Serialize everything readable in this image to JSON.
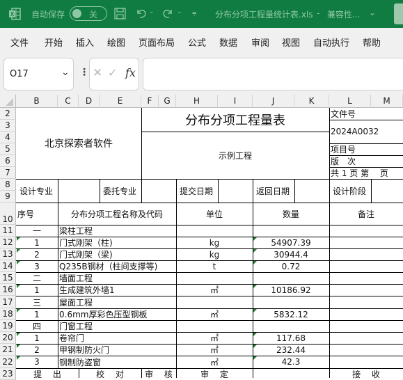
{
  "titlebar": {
    "autosave_label": "自动保存",
    "autosave_state": "关",
    "file_title": "分布分项工程量统计表.xls",
    "separator": "-",
    "mode": "兼容性..."
  },
  "menu": [
    "文件",
    "开始",
    "插入",
    "绘图",
    "页面布局",
    "公式",
    "数据",
    "审阅",
    "视图",
    "自动执行",
    "帮助"
  ],
  "formula_bar": {
    "name_box": "O17",
    "formula": ""
  },
  "columns": [
    "B",
    "C",
    "D",
    "E",
    "F",
    "G",
    "H",
    "I",
    "J",
    "K",
    "L",
    "M"
  ],
  "rows": [
    "2",
    "3",
    "4",
    "5",
    "6",
    "7",
    "8",
    "9",
    "10",
    "11",
    "12",
    "13",
    "14",
    "15",
    "16",
    "17",
    "18",
    "19",
    "20",
    "21",
    "22",
    "23"
  ],
  "sheet": {
    "company": "北京探索者软件",
    "title": "分布分项工程量表",
    "project_name": "示例工程",
    "file_no_label": "文件号",
    "file_no": "2024A0032",
    "project_no_label": "项目号",
    "version_label": "版　次",
    "pages_label": "共 1 页 第　 页",
    "design_major_label": "设计专业",
    "commission_major_label": "委托专业",
    "submit_date_label": "提交日期",
    "return_date_label": "返回日期",
    "design_stage_label": "设计阶段",
    "headers": {
      "seq": "序号",
      "name": "分布分项工程名称及代码",
      "unit": "单位",
      "qty": "数量",
      "remark": "备注"
    },
    "items": [
      {
        "seq": "一",
        "name": "梁柱工程",
        "unit": "",
        "qty": "",
        "flag": false
      },
      {
        "seq": "1",
        "name": "门式刚架（柱)",
        "unit": "kg",
        "qty": "54907.39",
        "flag": true
      },
      {
        "seq": "2",
        "name": "门式刚架（梁)",
        "unit": "kg",
        "qty": "30944.4",
        "flag": true
      },
      {
        "seq": "3",
        "name": "Q235B钢材（柱间支撑等)",
        "unit": "t",
        "qty": "0.72",
        "flag": true
      },
      {
        "seq": "二",
        "name": "墙面工程",
        "unit": "",
        "qty": "",
        "flag": false
      },
      {
        "seq": "1",
        "name": "生成建筑外墙1",
        "unit": "㎡",
        "qty": "10186.92",
        "flag": true
      },
      {
        "seq": "三",
        "name": "屋面工程",
        "unit": "",
        "qty": "",
        "flag": false
      },
      {
        "seq": "1",
        "name": "0.6mm厚彩色压型钢板",
        "unit": "㎡",
        "qty": "5832.12",
        "flag": true
      },
      {
        "seq": "四",
        "name": "门窗工程",
        "unit": "",
        "qty": "",
        "flag": false
      },
      {
        "seq": "1",
        "name": "卷帘门",
        "unit": "㎡",
        "qty": "117.68",
        "flag": true
      },
      {
        "seq": "2",
        "name": "甲钢制防火门",
        "unit": "㎡",
        "qty": "232.44",
        "flag": true
      },
      {
        "seq": "3",
        "name": "钢制防盗窗",
        "unit": "㎡",
        "qty": "42.3",
        "flag": true
      }
    ],
    "footer": {
      "propose": "提　 出",
      "check": "校　 对",
      "review": "审　 核",
      "approve": "审　 定",
      "receive": "接　 收"
    }
  },
  "colors": {
    "titlebar_bg": "#107c41",
    "error_triangle": "#1e7b34"
  }
}
